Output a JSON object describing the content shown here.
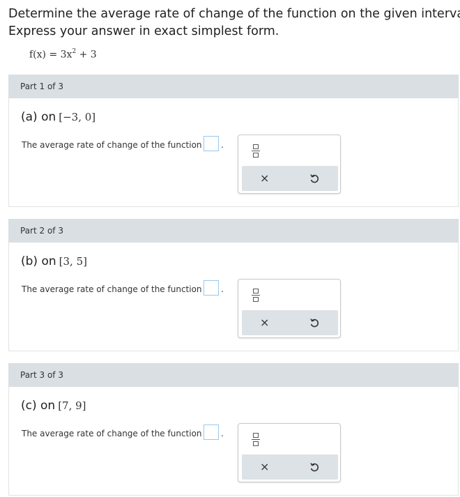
{
  "prompt": {
    "line1": "Determine the average rate of change of the function on the given interval.",
    "line2": "Express your answer in exact simplest form."
  },
  "formula": {
    "lhs": "f(x) = 3x",
    "exponent": "2",
    "rhs": " + 3"
  },
  "parts": [
    {
      "header": "Part 1 of 3",
      "label": "(a) on",
      "interval": "[−3, 0]",
      "statement": "The average rate of change of the function is",
      "period": "."
    },
    {
      "header": "Part 2 of 3",
      "label": "(b) on",
      "interval": "[3, 5]",
      "statement": "The average rate of change of the function is",
      "period": "."
    },
    {
      "header": "Part 3 of 3",
      "label": "(c) on",
      "interval": "[7, 9]",
      "statement": "The average rate of change of the function is",
      "period": "."
    }
  ],
  "palette": {
    "clear_symbol": "×"
  },
  "icons": [
    "fraction-icon",
    "clear-icon",
    "undo-icon"
  ]
}
